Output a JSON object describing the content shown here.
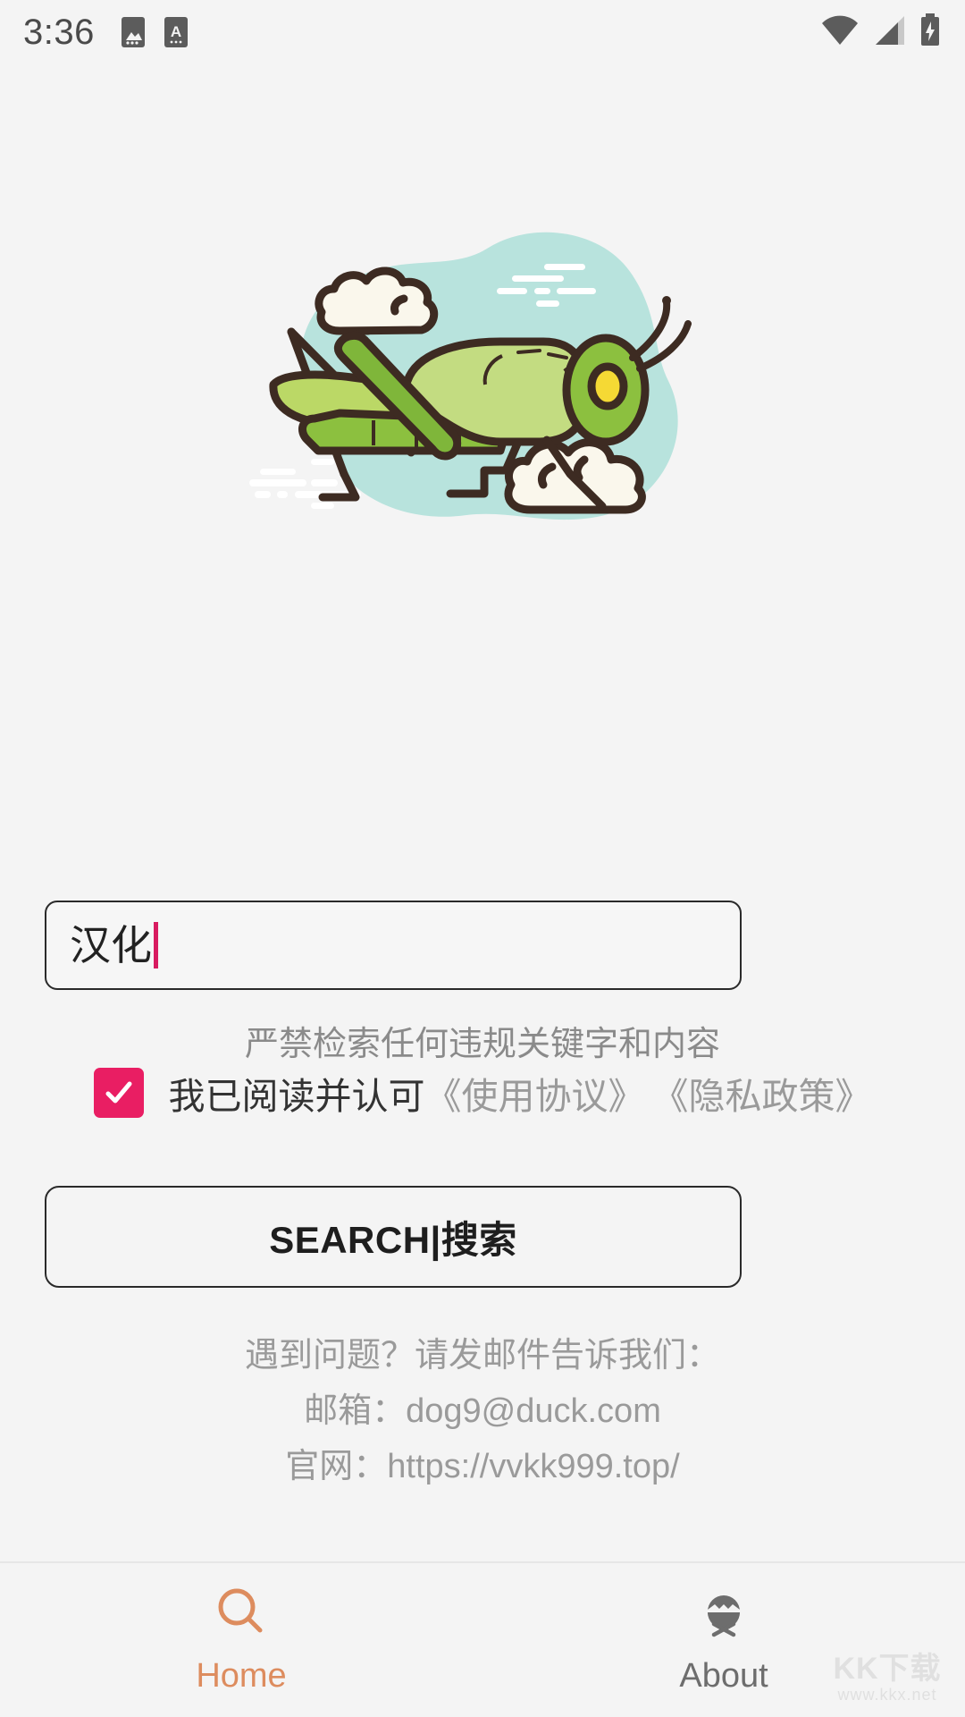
{
  "statusbar": {
    "time": "3:36",
    "left_icons": [
      "image-icon",
      "app-a-icon"
    ],
    "right_icons": [
      "wifi-icon",
      "cellular-signal-icon",
      "battery-charging-icon"
    ]
  },
  "hero": {
    "illustration": "grasshopper-illustration",
    "colors": {
      "blob": "#B8E3DD",
      "cloud": "#FAF7EC",
      "outline": "#3D2B22",
      "body_light": "#BBD866",
      "body_mid": "#8CC03F",
      "body_dark": "#7FB63A",
      "eye": "#F5D934",
      "wind": "#FFFFFF"
    }
  },
  "search": {
    "value": "汉化",
    "placeholder": "",
    "caret_color": "#D81B60"
  },
  "notice": "严禁检索任何违规关键字和内容",
  "agreement": {
    "checked": true,
    "checkbox_color": "#E91E63",
    "main_text": "我已阅读并认可",
    "links": [
      "《使用协议》",
      "《隐私政策》"
    ]
  },
  "search_button": {
    "label": "SEARCH|搜索"
  },
  "footer": {
    "line1": "遇到问题？请发邮件告诉我们：",
    "line2": "邮箱：dog9@duck.com",
    "line3": "官网：https://vvkk999.top/"
  },
  "bottomnav": {
    "active_color": "#DD8C5E",
    "inactive_color": "#6D6D6D",
    "items": [
      {
        "label": "Home",
        "icon": "search-icon",
        "active": true
      },
      {
        "label": "About",
        "icon": "bug-icon",
        "active": false
      }
    ]
  },
  "watermark": {
    "big": "KK下载",
    "small": "www.kkx.net"
  }
}
